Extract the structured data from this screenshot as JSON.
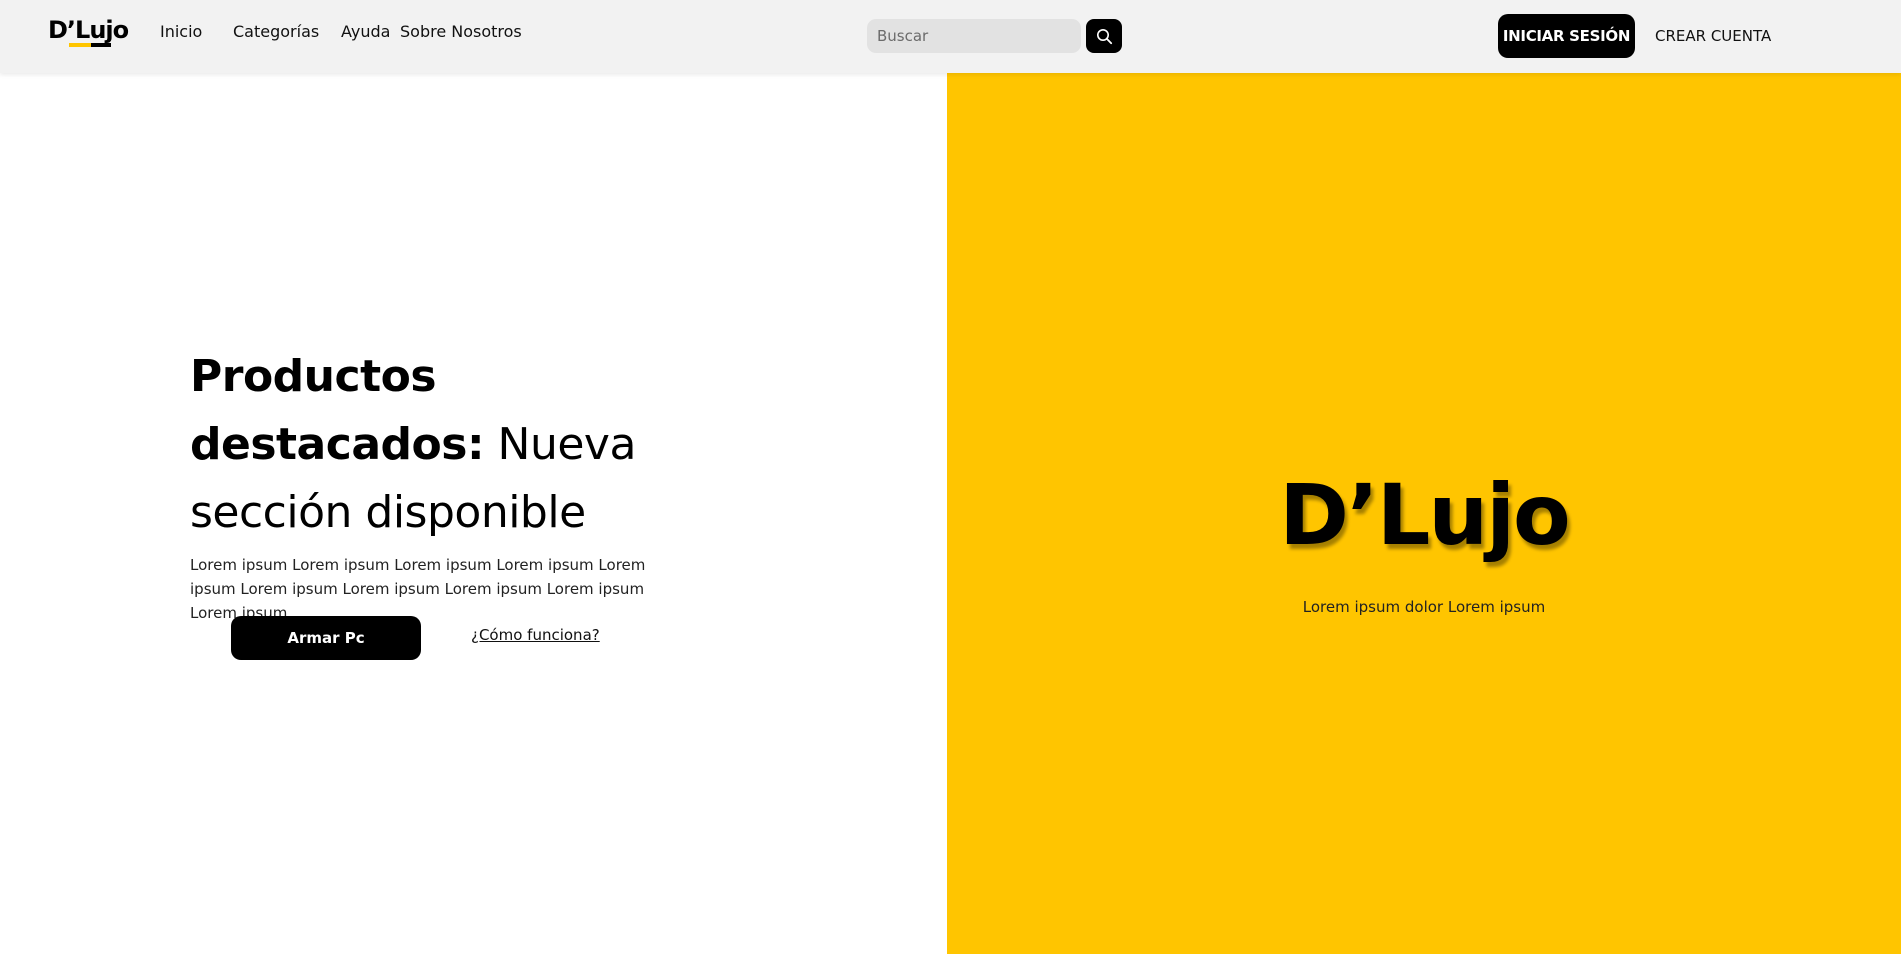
{
  "header": {
    "logo_text": "D’Lujo",
    "nav": {
      "inicio": "Inicio",
      "categorias": "Categorías",
      "ayuda": "Ayuda",
      "sobre": "Sobre Nosotros"
    },
    "search": {
      "placeholder": "Buscar",
      "icon": "search-icon"
    },
    "login_label": "INICIAR SESIÓN",
    "signup_label": "CREAR CUENTA"
  },
  "hero": {
    "title_bold": "Productos destacados:",
    "title_light": " Nueva sección disponible",
    "description": "Lorem ipsum Lorem ipsum Lorem ipsum Lorem ipsum Lorem ipsum Lorem ipsum Lorem ipsum Lorem ipsum Lorem ipsum Lorem ipsum",
    "primary_button": "Armar Pc",
    "secondary_link": "¿Cómo funciona?"
  },
  "brand_panel": {
    "title": "D’Lujo",
    "subtitle": "Lorem ipsum dolor Lorem ipsum"
  },
  "colors": {
    "accent_yellow": "#ffc500",
    "primary_black": "#000000",
    "header_bg": "#f2f2f2"
  }
}
